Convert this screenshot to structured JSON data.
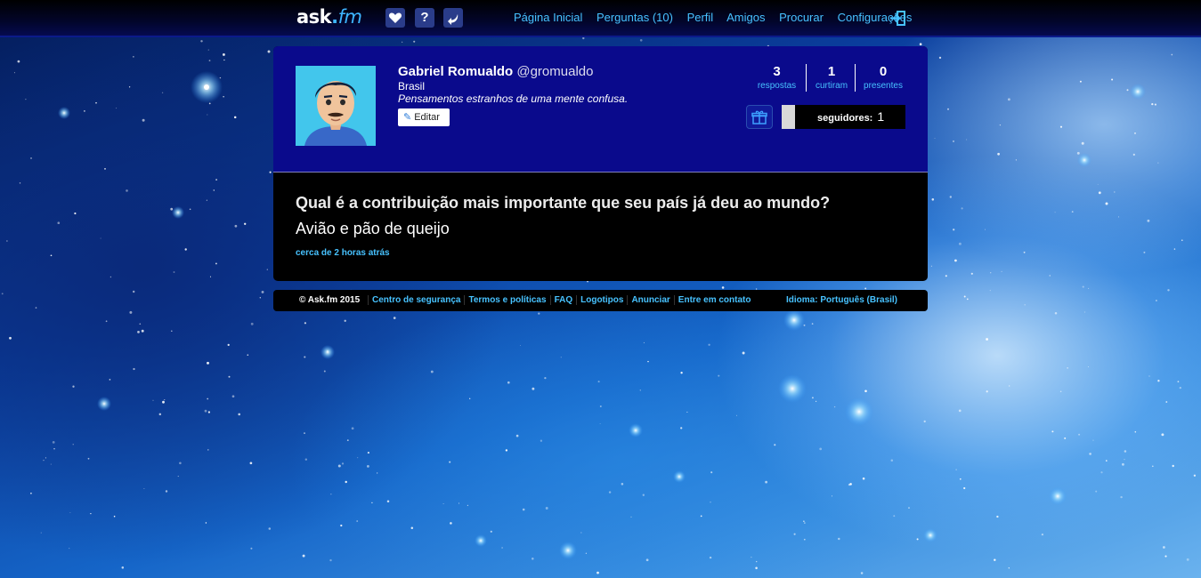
{
  "header": {
    "logo": {
      "main": "ask",
      "dot": ".",
      "suffix": "fm"
    },
    "icons": [
      "heart-icon",
      "question-icon",
      "reply-icon"
    ],
    "question_icon_glyph": "?",
    "nav": [
      "Página Inicial",
      "Perguntas (10)",
      "Perfil",
      "Amigos",
      "Procurar",
      "Configurações"
    ],
    "logout_icon": "logout-icon"
  },
  "profile": {
    "name": "Gabriel Romualdo",
    "handle": "@gromualdo",
    "country": "Brasil",
    "bio": "Pensamentos estranhos de uma mente confusa.",
    "edit_label": "Editar",
    "stats": [
      {
        "value": "3",
        "label": "respostas"
      },
      {
        "value": "1",
        "label": "curtiram"
      },
      {
        "value": "0",
        "label": "presentes"
      }
    ],
    "followers_label": "seguidores:",
    "followers_count": "1"
  },
  "post": {
    "question": "Qual é a contribuição mais importante que seu país já deu ao mundo?",
    "answer": "Avião e pão de queijo",
    "time": "cerca de 2 horas atrás"
  },
  "footer": {
    "copyright": "© Ask.fm 2015",
    "links": [
      "Centro de segurança",
      "Termos e políticas",
      "FAQ",
      "Logotipos",
      "Anunciar",
      "Entre em contato"
    ],
    "language": "Idioma: Português (Brasil)"
  },
  "colors": {
    "accent": "#47c2ff",
    "profile_bg": "#0a0a8c",
    "panel_bg": "#000000"
  }
}
